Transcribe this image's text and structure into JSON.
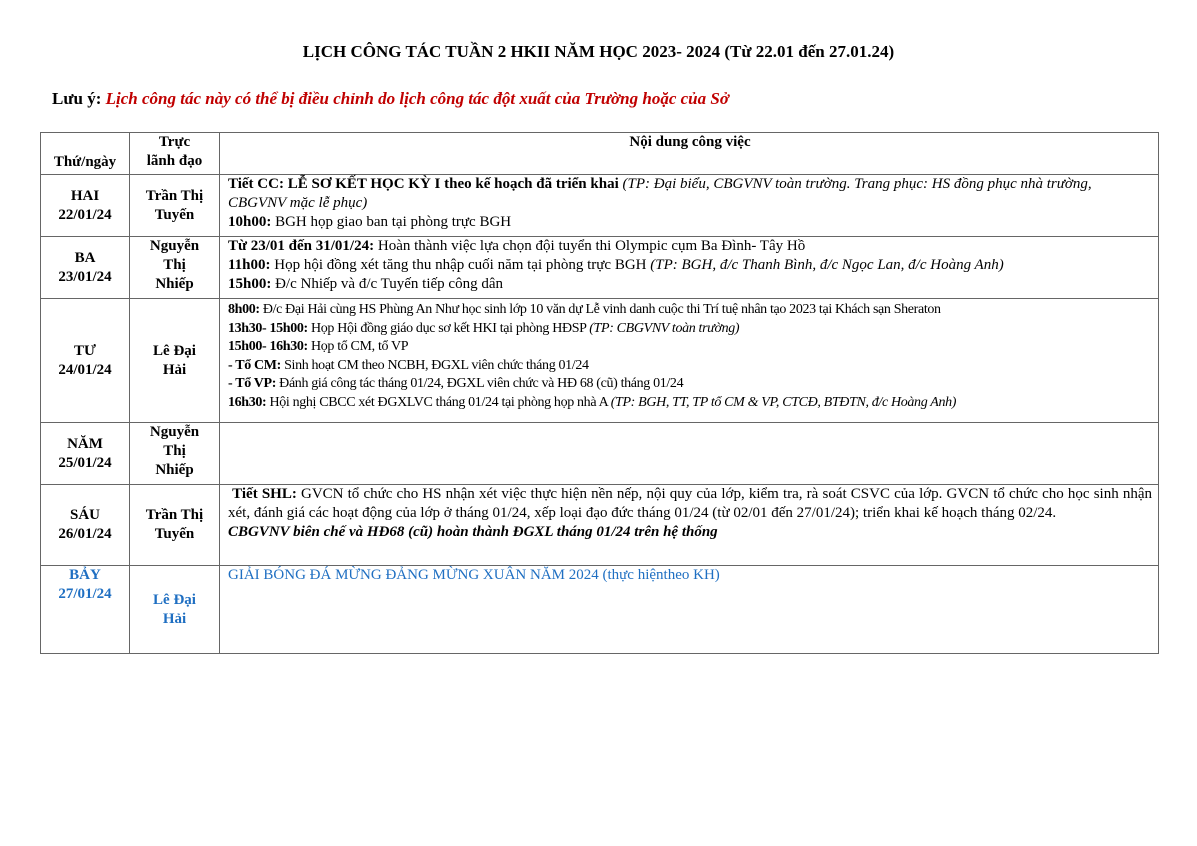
{
  "title": "LỊCH CÔNG TÁC TUẦN 2 HKII NĂM HỌC 2023- 2024 (Từ 22.01 đến 27.01.24)",
  "note": {
    "label": "Lưu ý:",
    "text": "Lịch công tác này có thể bị điều chỉnh do lịch công tác đột xuất của Trường hoặc của Sở",
    "color": "#c00000"
  },
  "headers": {
    "day": "Thứ/ngày",
    "leader_line1": "Trực",
    "leader_line2": "lãnh đạo",
    "content": "Nội dung công việc"
  },
  "rows": [
    {
      "day": "HAI",
      "date": "22/01/24",
      "leader_line1": "Trần Thị",
      "leader_line2": "Tuyến",
      "l1_bold": "Tiết CC: LỄ SƠ KẾT HỌC KỲ I theo kế hoạch đã triển khai",
      "l1_italic": " (TP: Đại biểu, CBGVNV toàn trường. Trang phục: HS đồng phục nhà trường, CBGVNV mặc lễ phục)",
      "l2_bold": "10h00:",
      "l2_text": " BGH họp giao ban tại phòng trực BGH"
    },
    {
      "day": "BA",
      "date": "23/01/24",
      "leader_line1": "Nguyễn",
      "leader_line2": "Thị",
      "leader_line3": "Nhiếp",
      "l1_bold": "Từ 23/01 đến 31/01/24:",
      "l1_text": " Hoàn thành việc lựa chọn đội tuyển thi Olympic cụm Ba Đình- Tây Hồ",
      "l2_bold": "11h00:",
      "l2_text": " Họp hội đồng xét tăng thu nhập cuối năm tại phòng trực BGH ",
      "l2_italic": "(TP: BGH, đ/c Thanh Bình, đ/c Ngọc Lan, đ/c Hoàng Anh)",
      "l3_bold": "15h00:",
      "l3_text": " Đ/c Nhiếp và đ/c Tuyến tiếp công dân"
    },
    {
      "day": "TƯ",
      "date": "24/01/24",
      "leader_line1": "Lê Đại",
      "leader_line2": "Hải",
      "l1_bold": "8h00:",
      "l1_text": " Đ/c Đại Hải cùng HS Phùng An Như học sinh lớp 10 văn dự Lễ vinh danh cuộc thi Trí tuệ nhân tạo 2023 tại Khách sạn Sheraton",
      "l2_bold": "13h30- 15h00:",
      "l2_text": " Họp Hội đồng giáo dục sơ kết HKI tại phòng HĐSP ",
      "l2_italic": "(TP: CBGVNV toàn trường)",
      "l3_bold": "15h00- 16h30:",
      "l3_text": " Họp tổ CM, tổ VP",
      "l4_bold": "- Tổ CM:",
      "l4_text": " Sinh hoạt CM theo NCBH, ĐGXL viên chức tháng 01/24",
      "l5_bold": "- Tổ VP:",
      "l5_text": " Đánh giá công tác tháng 01/24, ĐGXL viên chức và HĐ 68 (cũ) tháng 01/24",
      "l6_bold": "16h30:",
      "l6_text": " Hội nghị CBCC xét ĐGXLVC tháng 01/24 tại phòng họp nhà A ",
      "l6_italic": "(TP: BGH, TT, TP tổ CM & VP, CTCĐ, BTĐTN, đ/c Hoàng Anh)"
    },
    {
      "day": "NĂM",
      "date": "25/01/24",
      "leader_line1": "Nguyễn",
      "leader_line2": "Thị",
      "leader_line3": "Nhiếp"
    },
    {
      "day": "SÁU",
      "date": "26/01/24",
      "leader_line1": "Trần Thị",
      "leader_line2": "Tuyến",
      "l1_bold": "Tiết SHL:",
      "l1_text": " GVCN tổ chức cho HS nhận xét việc thực hiện nền nếp, nội quy của lớp, kiểm tra, rà soát CSVC của lớp. GVCN tổ chức cho học sinh nhận xét, đánh giá các hoạt động của lớp ở tháng 01/24, xếp loại đạo đức tháng 01/24 (từ 02/01 đến 27/01/24); triển khai kế hoạch tháng 02/24.",
      "l2_bolditalic": "CBGVNV biên chế và HĐ68 (cũ) hoàn thành ĐGXL tháng 01/24 trên hệ thống"
    },
    {
      "day": "BẢY",
      "date": "27/01/24",
      "leader_line1": "Lê Đại",
      "leader_line2": "Hải",
      "l1_text": "GIẢI BÓNG ĐÁ MỪNG ĐẢNG MỪNG XUÂN NĂM 2024 (thực hiệntheo KH)",
      "color": "#1f6fc2"
    }
  ]
}
